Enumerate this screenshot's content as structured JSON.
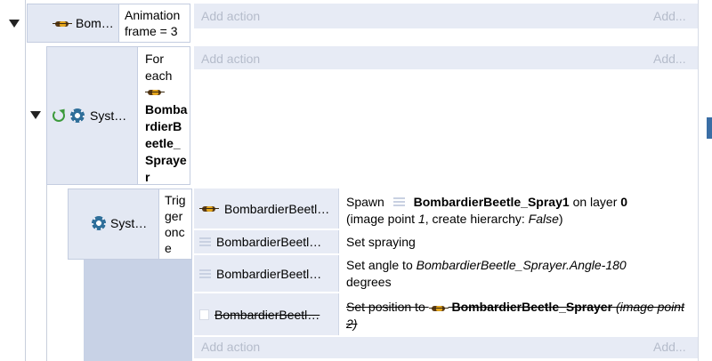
{
  "event1": {
    "object_name": "Bom…",
    "condition": "Animation frame = 3",
    "add_action": "Add action",
    "add_more": "Add..."
  },
  "event2": {
    "object_name": "Syst…",
    "for_each_label": "For each",
    "for_each_object": "BombardierBeetle_Sprayer",
    "add_action": "Add action",
    "add_more": "Add..."
  },
  "event3": {
    "object_name": "Syst…",
    "condition": "Trigger once",
    "add_action": "Add action",
    "add_more": "Add...",
    "actions": [
      {
        "object": "BombardierBeetl…",
        "icon": "beetle-icon",
        "text_spawn": "Spawn",
        "text_object": "BombardierBeetle_Spray1",
        "text_on_layer": "on layer",
        "text_layer": "0",
        "text_line2a": "(image point ",
        "text_point": "1",
        "text_line2b": ", create hierarchy: ",
        "text_hierarchy": "False",
        "text_line2c": ")"
      },
      {
        "object": "BombardierBeetl…",
        "icon": "lines-icon",
        "text": "Set spraying"
      },
      {
        "object": "BombardierBeetl…",
        "icon": "lines-icon",
        "text_prefix": "Set angle to ",
        "text_expr": "BombardierBeetle_Sprayer.Angle-180",
        "text_suffix": "degrees"
      },
      {
        "object": "BombardierBeetl…",
        "icon": "note-icon",
        "disabled": true,
        "text_prefix": "Set position to",
        "text_object": "BombardierBeetle_Sprayer",
        "text_suffix": "(image point 2)"
      }
    ]
  },
  "colors": {
    "block_bg": "#e3e8f3",
    "add_text": "#b5bccb",
    "gear": "#2f6f9a",
    "loop": "#3c9a3c"
  }
}
